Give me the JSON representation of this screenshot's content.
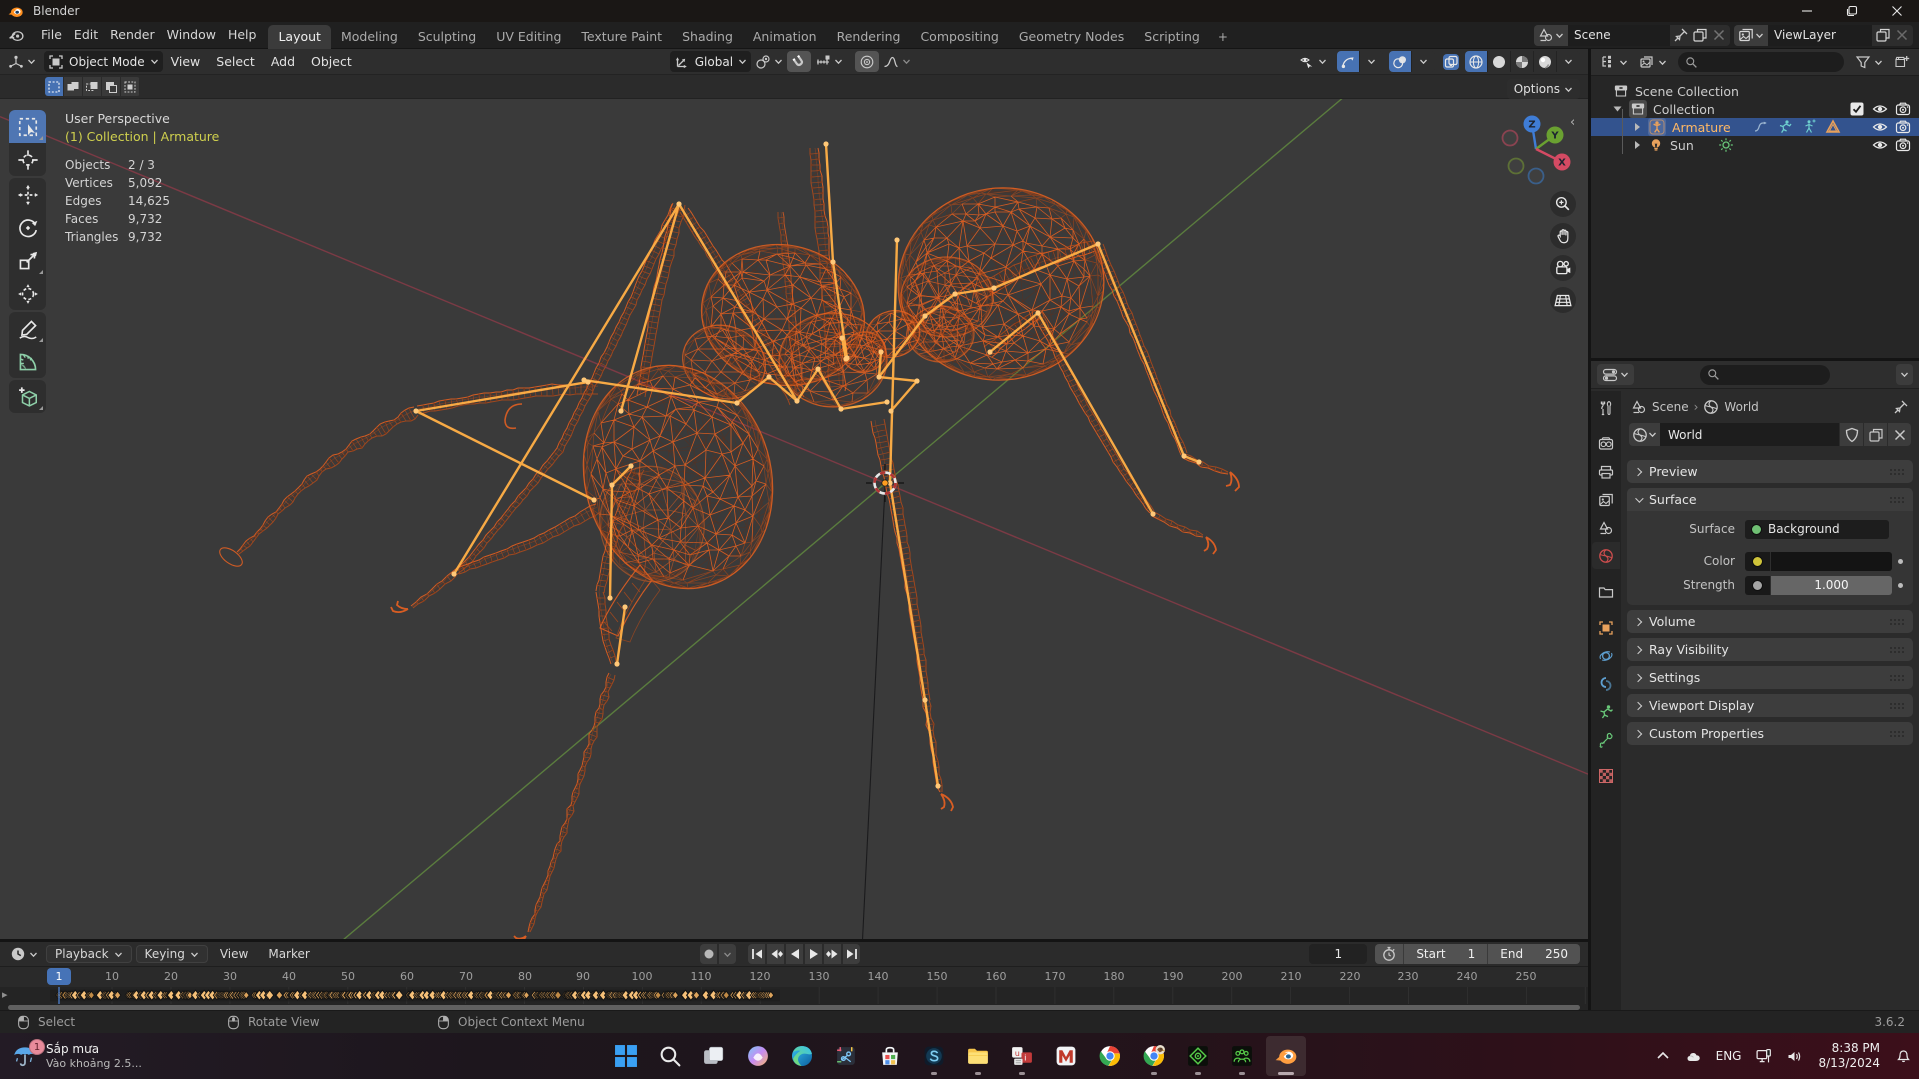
{
  "window": {
    "title": "Blender",
    "controls": [
      "minimize",
      "maximize",
      "close"
    ]
  },
  "menubar": {
    "items": [
      "File",
      "Edit",
      "Render",
      "Window",
      "Help"
    ]
  },
  "workspaces": {
    "tabs": [
      "Layout",
      "Modeling",
      "Sculpting",
      "UV Editing",
      "Texture Paint",
      "Shading",
      "Animation",
      "Rendering",
      "Compositing",
      "Geometry Nodes",
      "Scripting"
    ],
    "add_tab": "+",
    "active": "Layout"
  },
  "topbar": {
    "scene_value": "Scene",
    "viewlayer_value": "ViewLayer"
  },
  "viewport_header": {
    "mode": "Object Mode",
    "menus": [
      "View",
      "Select",
      "Add",
      "Object"
    ],
    "orientation": "Global",
    "options_label": "Options"
  },
  "viewport": {
    "projection": "User Perspective",
    "context": "(1) Collection | Armature",
    "stats": [
      {
        "label": "Objects",
        "value": "2 / 3"
      },
      {
        "label": "Vertices",
        "value": "5,092"
      },
      {
        "label": "Edges",
        "value": "14,625"
      },
      {
        "label": "Faces",
        "value": "9,732"
      },
      {
        "label": "Triangles",
        "value": "9,732"
      }
    ],
    "gizmo": {
      "x": "X",
      "y": "Y",
      "z": "Z"
    }
  },
  "outliner": {
    "rows": [
      {
        "label": "Scene Collection"
      },
      {
        "label": "Collection"
      },
      {
        "label": "Armature"
      },
      {
        "label": "Sun"
      }
    ]
  },
  "properties": {
    "breadcrumb": {
      "scene": "Scene",
      "world": "World"
    },
    "datablock_name": "World",
    "panels": {
      "preview": "Preview",
      "surface": "Surface",
      "volume": "Volume",
      "ray_visibility": "Ray Visibility",
      "settings": "Settings",
      "viewport_display": "Viewport Display",
      "custom_properties": "Custom Properties"
    },
    "surface": {
      "surface_label": "Surface",
      "surface_value": "Background",
      "color_label": "Color",
      "strength_label": "Strength",
      "strength_value": "1.000"
    }
  },
  "timeline": {
    "menus": [
      "Playback",
      "Keying",
      "View",
      "Marker"
    ],
    "current_frame": "1",
    "start_label": "Start",
    "start_value": "1",
    "end_label": "End",
    "end_value": "250",
    "ticks": [
      "10",
      "20",
      "30",
      "40",
      "50",
      "60",
      "70",
      "80",
      "90",
      "100",
      "110",
      "120",
      "130",
      "140",
      "150",
      "160",
      "170",
      "180",
      "190",
      "200",
      "210",
      "220",
      "230",
      "240",
      "250"
    ]
  },
  "statusbar": {
    "hints": [
      {
        "label": "Select"
      },
      {
        "label": "Rotate View"
      },
      {
        "label": "Object Context Menu"
      }
    ],
    "version": "3.6.2"
  },
  "taskbar": {
    "badge_count": "1",
    "weather_title": "Sắp mưa",
    "weather_sub": "Vào khoảng 2.5...",
    "tray": {
      "lang": "ENG",
      "time": "8:38 PM",
      "date": "8/13/2024"
    }
  },
  "colors": {
    "accent_blue": "#4772b3",
    "selected_orange": "#ffaf46",
    "wire_orange": "#c65620",
    "axis_x_red": "#7e3a46",
    "axis_y_green": "#5c7f3e"
  }
}
